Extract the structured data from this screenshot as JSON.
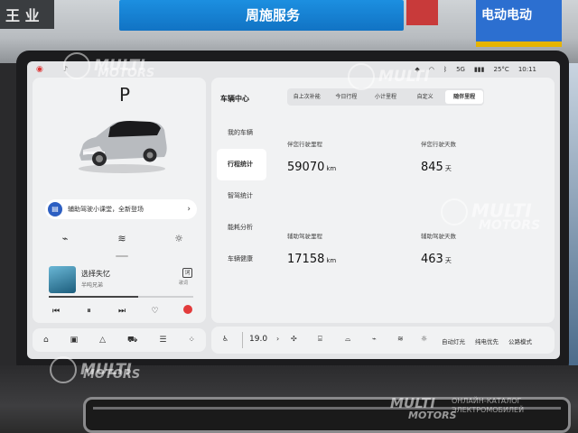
{
  "status_bar": {
    "temperature": "25°C",
    "time": "10:11",
    "signal": "5G",
    "icons": [
      "location-icon",
      "wifi-icon",
      "bluetooth-icon",
      "signal-icon"
    ]
  },
  "left_panel": {
    "gear": "P",
    "promo": {
      "text": "辅助驾驶小课堂，全新登场",
      "icon": "book-icon",
      "arrow": "›"
    },
    "quick_icons": [
      "wiper-icon",
      "seat-heat-icon",
      "light-icon"
    ],
    "music": {
      "title": "选择失忆",
      "artist": "半吨兄弟",
      "lyric_label": "歌词",
      "progress": 0.62
    }
  },
  "dock_left": [
    "home-icon",
    "apps-icon",
    "nav-icon",
    "car-icon",
    "media-icon",
    "grid-icon"
  ],
  "vehicle_center": {
    "title": "车辆中心",
    "tabs": [
      "自上次补能",
      "今日行程",
      "小计里程",
      "自定义",
      "随伴里程"
    ],
    "active_tab": 4,
    "nav": [
      "我的车辆",
      "行程统计",
      "智驾统计",
      "能耗分析",
      "车辆健康"
    ],
    "active_nav": 1,
    "stats": {
      "total_km_label": "伴您行驶里程",
      "total_km": "59070",
      "total_km_unit": "km",
      "total_days_label": "伴您行驶天数",
      "total_days": "845",
      "total_days_unit": "天",
      "assist_km_label": "辅助驾驶里程",
      "assist_km": "17158",
      "assist_km_unit": "km",
      "assist_days_label": "辅助驾驶天数",
      "assist_days": "463",
      "assist_days_unit": "天"
    }
  },
  "dock_right": {
    "temperature": "19.0",
    "labels": [
      "自动灯光",
      "纯电优先",
      "公路模式"
    ]
  },
  "watermarks": {
    "brand_top": "MULTI",
    "brand_bottom": "MOTORS",
    "sub_line1": "ОНЛАЙН-КАТАЛОГ",
    "sub_line2": "ЭЛЕКТРОМОБИЛЕЙ"
  },
  "background_signs": {
    "left": "王 业",
    "blue": "周施服务",
    "right": "电动电动"
  }
}
